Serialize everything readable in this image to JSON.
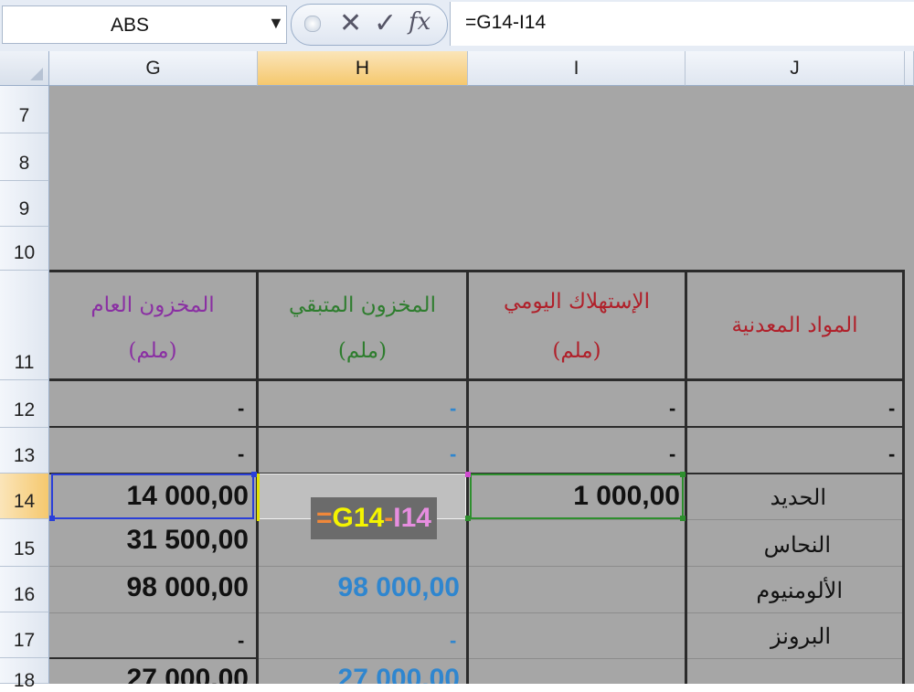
{
  "formula_bar": {
    "name_box": "ABS",
    "cancel_symbol": "✕",
    "enter_symbol": "✓",
    "fx_symbol": "fx",
    "formula": "=G14-I14"
  },
  "columns": [
    "G",
    "H",
    "I",
    "J"
  ],
  "rows": [
    "7",
    "8",
    "9",
    "10",
    "11",
    "12",
    "13",
    "14",
    "15",
    "16",
    "17",
    "18"
  ],
  "table": {
    "headers": {
      "G": {
        "line1": "المخزون العام",
        "line2": "(ملم)"
      },
      "H": {
        "line1": "المخزون المتبقي",
        "line2": "(ملم)"
      },
      "I": {
        "line1": "الإستهلاك اليومي",
        "line2": "(ملم)"
      },
      "J": {
        "line1": "المواد المعدنية"
      }
    },
    "r12": {
      "G": "-",
      "H": "-",
      "I": "-",
      "J": "-"
    },
    "r13": {
      "G": "-",
      "H": "-",
      "I": "-",
      "J": "-"
    },
    "r14": {
      "G": "14 000,00",
      "I": "1 000,00",
      "J": "الحديد"
    },
    "r15": {
      "G": "31 500,00",
      "J": "النحاس"
    },
    "r16": {
      "G": "98 000,00",
      "H": "98 000,00",
      "J": "الألومنيوم"
    },
    "r17": {
      "G": "-",
      "H": "-",
      "J": "البرونز"
    },
    "r18": {
      "G": "27 000,00",
      "H": "27 000,00"
    }
  },
  "editing_cell": {
    "address": "H14",
    "eq": "=",
    "ref1": "G14",
    "op": "-",
    "ref2": "I14"
  },
  "colors": {
    "sheet_background": "#a6a6a6",
    "header_g": "#8a2fa3",
    "header_h": "#2e7d2e",
    "header_i": "#b0202a",
    "header_j": "#b0202a",
    "blue_values": "#2f86cf",
    "selected_header": "#f5c86e"
  }
}
